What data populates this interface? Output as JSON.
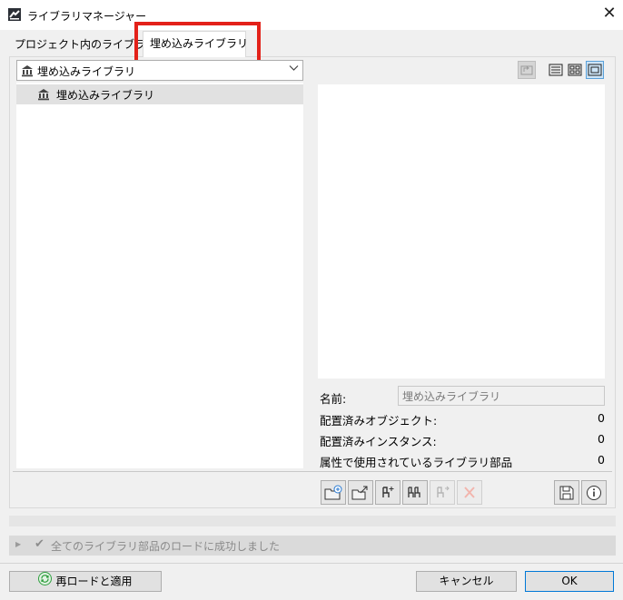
{
  "window": {
    "title": "ライブラリマネージャー",
    "close_glyph": "✕",
    "icon": "archicad-app-icon"
  },
  "tabs": [
    {
      "label": "プロジェクト内のライブラリ",
      "active": false
    },
    {
      "label": "埋め込みライブラリ",
      "active": true,
      "highlighted": true,
      "highlight_color": "#e32119"
    }
  ],
  "library_selector": {
    "value": "埋め込みライブラリ",
    "icon": "library-building-icon"
  },
  "tree": {
    "items": [
      {
        "label": "埋め込みライブラリ",
        "icon": "library-building-icon",
        "selected": true
      }
    ]
  },
  "view_buttons": [
    {
      "name": "up-folder-icon",
      "enabled": false
    },
    {
      "name": "list-view-icon",
      "enabled": true
    },
    {
      "name": "grid-view-icon",
      "enabled": true
    },
    {
      "name": "preview-view-icon",
      "enabled": true,
      "active": true
    }
  ],
  "info": {
    "name_label": "名前:",
    "name_value": "埋め込みライブラリ",
    "placed_objects_label": "配置済みオブジェクト:",
    "placed_objects_value": "0",
    "placed_instances_label": "配置済みインスタンス:",
    "placed_instances_value": "0",
    "attribute_parts_label": "属性で使用されているライブラリ部品",
    "attribute_parts_value": "0"
  },
  "toolbar": {
    "buttons": [
      {
        "name": "new-folder-icon",
        "enabled": true
      },
      {
        "name": "export-folder-icon",
        "enabled": true
      },
      {
        "name": "chair-add-icon",
        "enabled": true
      },
      {
        "name": "chairs-icon",
        "enabled": true
      },
      {
        "name": "chair-move-icon",
        "enabled": false
      },
      {
        "name": "delete-icon",
        "enabled": false
      },
      {
        "name": "save-icon",
        "enabled": true
      },
      {
        "name": "info-icon",
        "enabled": true
      }
    ]
  },
  "status": {
    "text": "全てのライブラリ部品のロードに成功しました",
    "icon": "check-icon"
  },
  "buttons": {
    "reload": "再ロードと適用",
    "cancel": "キャンセル",
    "ok": "OK"
  },
  "colors": {
    "highlight": "#e32119",
    "accent": "#0078d7",
    "reload_icon": "#2e9e3e"
  }
}
